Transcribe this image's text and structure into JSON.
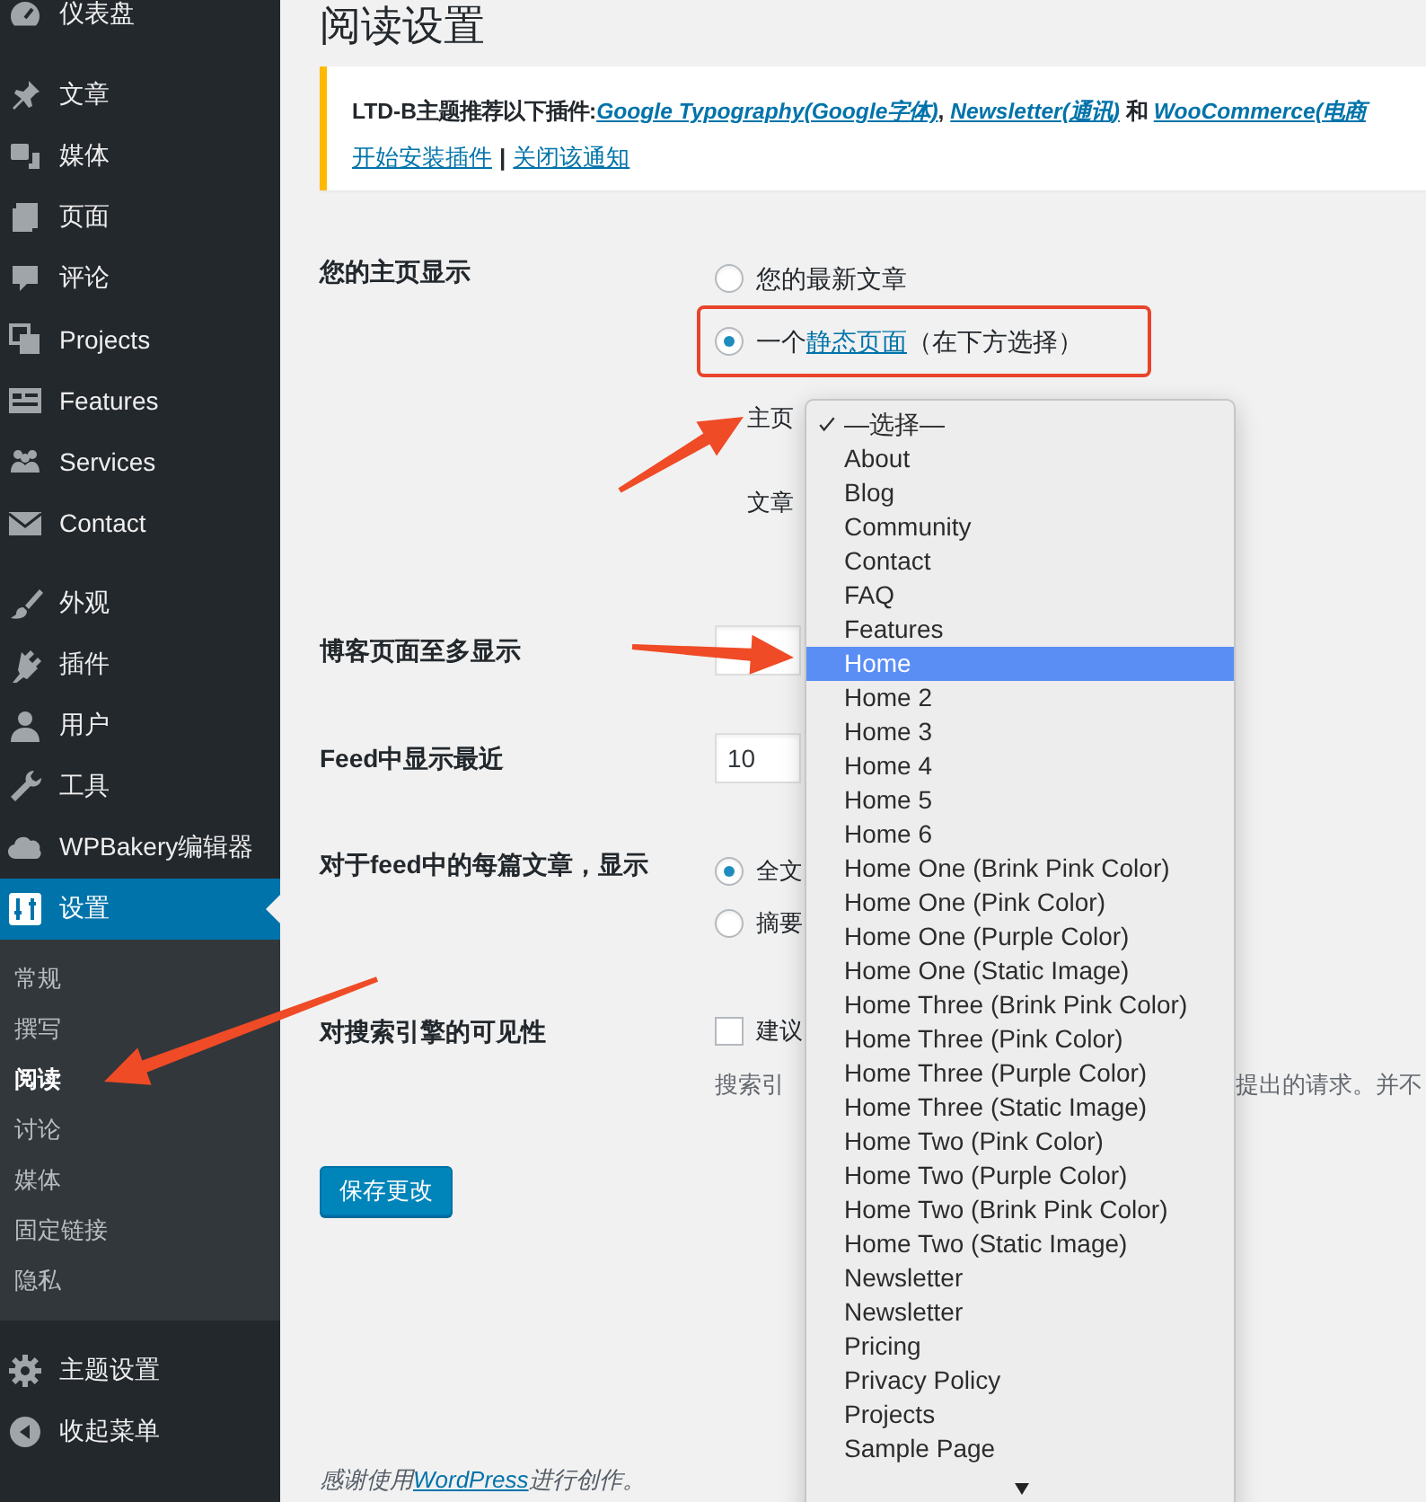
{
  "sidebar": {
    "groups": [
      [
        {
          "label": "仪表盘",
          "selected": false
        }
      ],
      [
        {
          "label": "文章",
          "selected": false
        },
        {
          "label": "媒体",
          "selected": false
        },
        {
          "label": "页面",
          "selected": false
        },
        {
          "label": "评论",
          "selected": false
        },
        {
          "label": "Projects",
          "selected": false
        },
        {
          "label": "Features",
          "selected": false
        },
        {
          "label": "Services",
          "selected": false
        },
        {
          "label": "Contact",
          "selected": false
        }
      ],
      [
        {
          "label": "外观",
          "selected": false
        },
        {
          "label": "插件",
          "selected": false
        },
        {
          "label": "用户",
          "selected": false
        },
        {
          "label": "工具",
          "selected": false
        },
        {
          "label": "WPBakery编辑器",
          "selected": false
        },
        {
          "label": "设置",
          "selected": true,
          "children": [
            {
              "label": "常规",
              "selected": false
            },
            {
              "label": "撰写",
              "selected": false
            },
            {
              "label": "阅读",
              "selected": true
            },
            {
              "label": "讨论",
              "selected": false
            },
            {
              "label": "媒体",
              "selected": false
            },
            {
              "label": "固定链接",
              "selected": false
            },
            {
              "label": "隐私",
              "selected": false
            }
          ]
        }
      ],
      [
        {
          "label": "主题设置",
          "selected": false
        },
        {
          "label": "收起菜单",
          "selected": false
        }
      ]
    ]
  },
  "title": "阅读设置",
  "notice": {
    "intro": "LTD-B主题推荐以下插件:",
    "plugins": [
      "Google Typography(Google字体)",
      "Newsletter(通讯)",
      "WooCommerce(电商"
    ],
    "joiners": [
      ",",
      "和"
    ],
    "actions": [
      "开始安装插件",
      "关闭该通知"
    ],
    "separator": "|"
  },
  "rows": [
    {
      "kind": "radio",
      "label": "您的主页显示",
      "options": [
        {
          "prefix": "您的最新文章",
          "selected": false
        },
        {
          "prefix": "一个",
          "link": "静态页面",
          "suffix": "（在下方选择）",
          "selected": true,
          "highlighted": true
        }
      ]
    },
    {
      "kind": "page-selects",
      "selects": [
        {
          "label": "主页",
          "options": [
            {
              "label": "—选择—",
              "selected": true,
              "highlighted": false
            },
            {
              "label": "About",
              "selected": false,
              "highlighted": false
            },
            {
              "label": "Blog",
              "selected": false,
              "highlighted": false
            },
            {
              "label": "Community",
              "selected": false,
              "highlighted": false
            },
            {
              "label": "Contact",
              "selected": false,
              "highlighted": false
            },
            {
              "label": "FAQ",
              "selected": false,
              "highlighted": false
            },
            {
              "label": "Features",
              "selected": false,
              "highlighted": false
            },
            {
              "label": "Home",
              "selected": false,
              "highlighted": true
            },
            {
              "label": "Home 2",
              "selected": false,
              "highlighted": false
            },
            {
              "label": "Home 3",
              "selected": false,
              "highlighted": false
            },
            {
              "label": "Home 4",
              "selected": false,
              "highlighted": false
            },
            {
              "label": "Home 5",
              "selected": false,
              "highlighted": false
            },
            {
              "label": "Home 6",
              "selected": false,
              "highlighted": false
            },
            {
              "label": "Home One (Brink Pink Color)",
              "selected": false,
              "highlighted": false
            },
            {
              "label": "Home One (Pink Color)",
              "selected": false,
              "highlighted": false
            },
            {
              "label": "Home One (Purple Color)",
              "selected": false,
              "highlighted": false
            },
            {
              "label": "Home One (Static Image)",
              "selected": false,
              "highlighted": false
            },
            {
              "label": "Home Three (Brink Pink Color)",
              "selected": false,
              "highlighted": false
            },
            {
              "label": "Home Three (Pink Color)",
              "selected": false,
              "highlighted": false
            },
            {
              "label": "Home Three (Purple Color)",
              "selected": false,
              "highlighted": false
            },
            {
              "label": "Home Three (Static Image)",
              "selected": false,
              "highlighted": false
            },
            {
              "label": "Home Two (Pink Color)",
              "selected": false,
              "highlighted": false
            },
            {
              "label": "Home Two (Purple Color)",
              "selected": false,
              "highlighted": false
            },
            {
              "label": "Home Two (Brink Pink Color)",
              "selected": false,
              "highlighted": false
            },
            {
              "label": "Home Two (Static Image)",
              "selected": false,
              "highlighted": false
            },
            {
              "label": "Newsletter",
              "selected": false,
              "highlighted": false
            },
            {
              "label": "Newsletter",
              "selected": false,
              "highlighted": false
            },
            {
              "label": "Pricing",
              "selected": false,
              "highlighted": false
            },
            {
              "label": "Privacy Policy",
              "selected": false,
              "highlighted": false
            },
            {
              "label": "Projects",
              "selected": false,
              "highlighted": false
            },
            {
              "label": "Sample Page",
              "selected": false,
              "highlighted": false
            }
          ]
        },
        {
          "label": "文章"
        }
      ]
    },
    {
      "kind": "number",
      "label": "博客页面至多显示"
    },
    {
      "kind": "number",
      "label": "Feed中显示最近",
      "value": "10"
    },
    {
      "kind": "radio",
      "label": "对于feed中的每篇文章，显示",
      "options": [
        {
          "prefix": "全文",
          "selected": true
        },
        {
          "prefix": "摘要",
          "selected": false
        }
      ]
    },
    {
      "kind": "checkbox",
      "label": "对搜索引擎的可见性",
      "option": "建议",
      "checked": false,
      "description": [
        "搜索引",
        "提出的请求。并不"
      ]
    }
  ],
  "save_button": "保存更改",
  "footer": {
    "prefix": "感谢使用",
    "link": "WordPress",
    "suffix": "进行创作。"
  },
  "annotations": [
    {
      "kind": "arrow"
    },
    {
      "kind": "arrow"
    },
    {
      "kind": "arrow"
    }
  ]
}
